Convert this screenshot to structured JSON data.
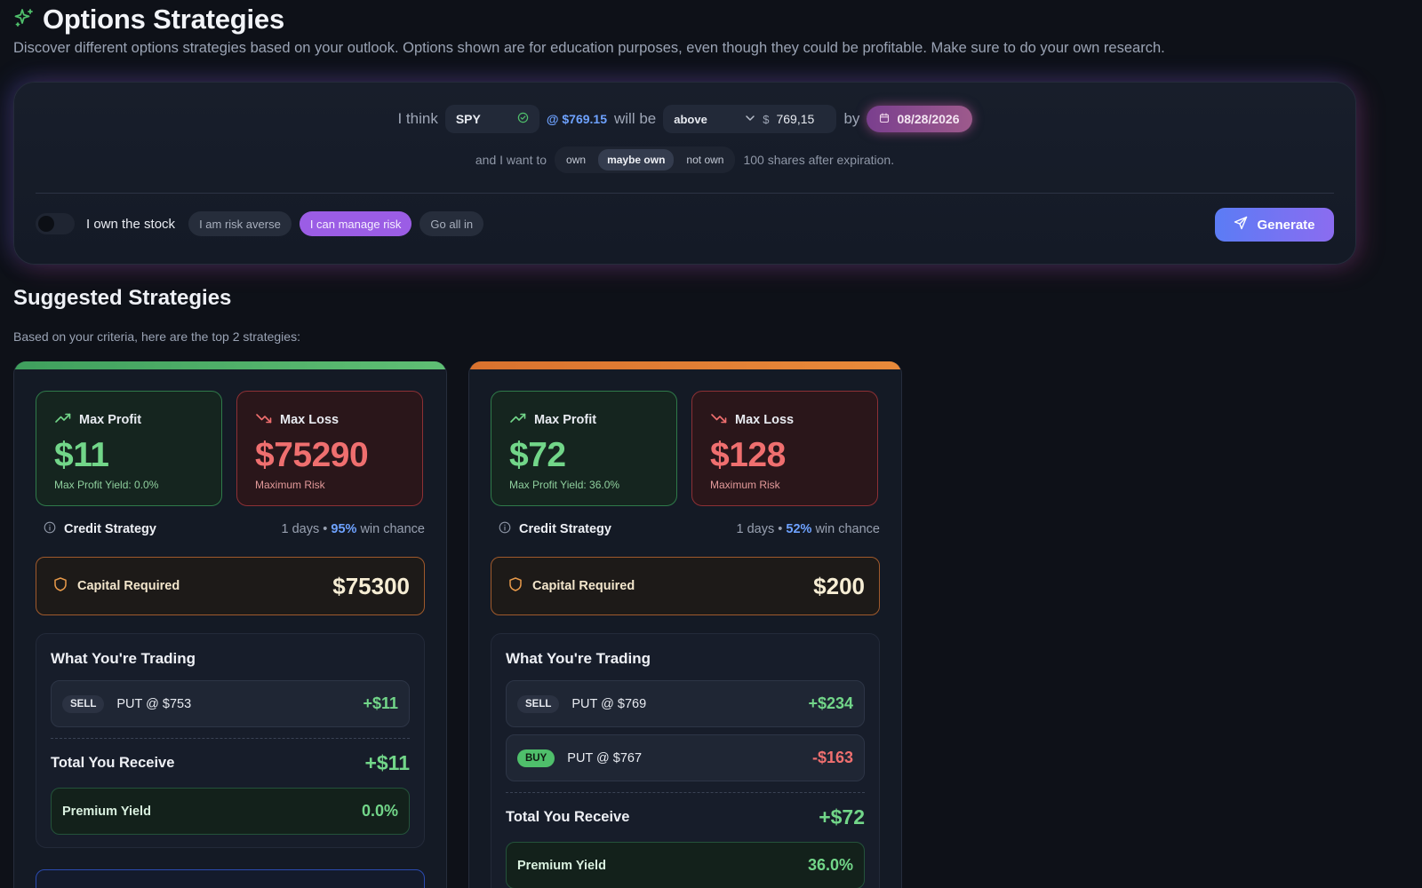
{
  "header": {
    "title": "Options Strategies",
    "subtitle": "Discover different options strategies based on your outlook. Options shown are for education purposes, even though they could be profitable. Make sure to do your own research.",
    "icon": "sparkle-icon"
  },
  "form": {
    "i_think": "I think",
    "ticker": "SPY",
    "current_price": "@ $769.15",
    "will_be": "will be",
    "direction": "above",
    "currency": "$",
    "target_price": "769,15",
    "by": "by",
    "date": "08/28/2026",
    "want_prefix": "and I want to",
    "ownership_options": [
      "own",
      "maybe own",
      "not own"
    ],
    "ownership_selected": "maybe own",
    "want_suffix": "100 shares after expiration.",
    "own_stock_label": "I own the stock",
    "own_stock_on": false,
    "risk_options": [
      "I am risk averse",
      "I can manage risk",
      "Go all in"
    ],
    "risk_selected": "I can manage risk",
    "generate_label": "Generate"
  },
  "suggested": {
    "title": "Suggested Strategies",
    "subtitle": "Based on your criteria, here are the top 2 strategies:"
  },
  "cards": [
    {
      "accent": "#4fae67",
      "max_profit_label": "Max Profit",
      "max_profit": "$11",
      "max_profit_note": "Max Profit Yield: 0.0%",
      "max_loss_label": "Max Loss",
      "max_loss": "$75290",
      "max_loss_note": "Maximum Risk",
      "strategy_type": "Credit Strategy",
      "days": "1 days",
      "sep": "•",
      "win_pct": "95%",
      "win_label": "win chance",
      "capital_label": "Capital Required",
      "capital": "$75300",
      "trading_title": "What You're Trading",
      "legs": [
        {
          "side": "SELL",
          "desc": "PUT @ $753",
          "amount": "+$11"
        }
      ],
      "total_label": "Total You Receive",
      "total": "+$11",
      "yield_label": "Premium Yield",
      "yield": "0.0%"
    },
    {
      "accent": "#e27f35",
      "max_profit_label": "Max Profit",
      "max_profit": "$72",
      "max_profit_note": "Max Profit Yield: 36.0%",
      "max_loss_label": "Max Loss",
      "max_loss": "$128",
      "max_loss_note": "Maximum Risk",
      "strategy_type": "Credit Strategy",
      "days": "1 days",
      "sep": "•",
      "win_pct": "52%",
      "win_label": "win chance",
      "capital_label": "Capital Required",
      "capital": "$200",
      "trading_title": "What You're Trading",
      "legs": [
        {
          "side": "SELL",
          "desc": "PUT @ $769",
          "amount": "+$234"
        },
        {
          "side": "BUY",
          "desc": "PUT @ $767",
          "amount": "-$163"
        }
      ],
      "total_label": "Total You Receive",
      "total": "+$72",
      "yield_label": "Premium Yield",
      "yield": "36.0%"
    }
  ]
}
